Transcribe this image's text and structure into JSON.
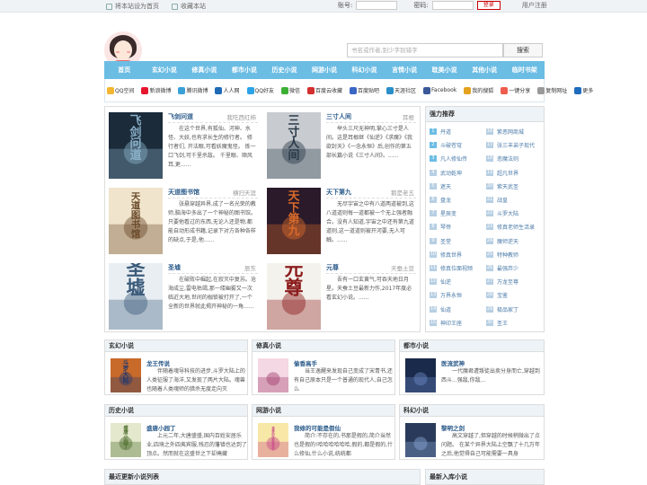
{
  "topbar": {
    "set_home": "将本站设为首页",
    "favorite": "收藏本站",
    "account_label": "账号:",
    "password_label": "密码:",
    "login": "登录",
    "register": "用户注册"
  },
  "search": {
    "placeholder": "书名或作者,别少字别错字",
    "button": "搜索"
  },
  "nav": [
    "首页",
    "玄幻小说",
    "修真小说",
    "都市小说",
    "历史小说",
    "网游小说",
    "科幻小说",
    "言情小说",
    "耽美小说",
    "其他小说",
    "临时书架"
  ],
  "share": [
    {
      "label": "QQ空间",
      "color": "#f2b631"
    },
    {
      "label": "新浪微博",
      "color": "#e6162d"
    },
    {
      "label": "腾讯微博",
      "color": "#3aa1d8"
    },
    {
      "label": "人人网",
      "color": "#1f6ab5"
    },
    {
      "label": "QQ好友",
      "color": "#2ba3e6"
    },
    {
      "label": "微信",
      "color": "#3cb035"
    },
    {
      "label": "百度云收藏",
      "color": "#d32f2f"
    },
    {
      "label": "百度贴吧",
      "color": "#3a66c4"
    },
    {
      "label": "天涯社区",
      "color": "#2a8fc9"
    },
    {
      "label": "Facebook",
      "color": "#3b5998"
    },
    {
      "label": "我的搜狐",
      "color": "#e4a21f"
    },
    {
      "label": "一键分享",
      "color": "#ed5c4d"
    },
    {
      "label": "复制网址",
      "color": "#999999"
    },
    {
      "label": "更多",
      "color": "#1f6bbd"
    }
  ],
  "books": [
    {
      "title": "飞剑问道",
      "author": "我吃西红柿",
      "desc": "在这个世界,有狐仙、河神、水怪、大妖,也有求长生的修行者。 修行者们, 开法眼,可看妖魔鬼怪。 炼一口飞剑,可千里杀敌。 千里眼、顺风耳,更......",
      "cover": [
        "#1b2b3a",
        "#8ab0c8"
      ],
      "cover_text": "飞剑问道"
    },
    {
      "title": "三寸人间",
      "author": "耳根",
      "desc": "举头三尺无神明,掌心三寸是人间。这是耳根继《仙逆》《求魔》《我欲封天》《一念永恒》后,创作的第五部长篇小说《三寸人间》。......",
      "cover": [
        "#c8ccd0",
        "#2a3a4a"
      ],
      "cover_text": "三寸人间"
    },
    {
      "title": "天道图书馆",
      "author": "横扫天涯",
      "desc": "张悬穿越异界,成了一名光荣的教师,脑海中多出了一个神秘的图书馆。只要他看过的东西,无论人还是物,都能自动形成书籍,记录下对方各种各样的缺点,于是,他......",
      "cover": [
        "#f0e4cc",
        "#6a4a2a"
      ],
      "cover_text": "天道图书馆"
    },
    {
      "title": "天下第九",
      "author": "鹅是老五",
      "desc": "无尽宇宙之中有八道两道被到,这八道道则每一道都被一个无上强者融合。没有人知道,宇宙之中还有第九道道则,这一道道则被开河要,无人可触。......",
      "cover": [
        "#2a1a2a",
        "#d86a2a"
      ],
      "cover_text": "天下第九"
    },
    {
      "title": "圣墟",
      "author": "辰东",
      "desc": "在破败中崛起,在寂灭中复苏。沧海成尘,雷电枯竭,那一缕幽雾又一次临近大地,世间的枷锁被打开了,一个全新的世界就此揭开神秘的一角......",
      "cover": [
        "#e8eef2",
        "#3a5a7a"
      ],
      "cover_text": "圣墟"
    },
    {
      "title": "元尊",
      "author": "天蚕土豆",
      "desc": "吾有一口玄黄气,可吞天地日月星。天蚕土豆最新力作,2017年度必看玄幻小说。......",
      "cover": [
        "#f4f2ec",
        "#8a1a1a"
      ],
      "cover_text": "元尊"
    }
  ],
  "rank": {
    "title": "强力推荐",
    "left": [
      "丹道",
      "斗破苍穹",
      "凡人修仙传",
      "武动乾坤",
      "遮天",
      "盘龙",
      "星辰变",
      "琴帝",
      "圣堂",
      "修真世界",
      "修真位面视频",
      "仙逆",
      "万界永恒",
      "仙道",
      "神印王座"
    ],
    "right": [
      "紫恶网商城",
      "张三丰弟子现代",
      "悲魔法则",
      "超凡世界",
      "紫天武圣",
      "战皇",
      "斗罗大陆",
      "修真老师生活录",
      "魔师逆天",
      "特种教师",
      "最强弃少",
      "万龙至尊",
      "宝鉴",
      "极品家丁",
      "圣王"
    ]
  },
  "sections": [
    {
      "name": "玄幻小说",
      "book": "龙王传说",
      "desc": "伴随着魂导科技的进步,斗罗大陆上的人类征服了海洋,又发现了两片大陆。魂兽也随着人类魂师的猎杀无度走向灭",
      "cover": [
        "#c86a2a",
        "#2a3a6a"
      ],
      "cover_text": "斗罗大陆"
    },
    {
      "name": "修真小说",
      "book": "偷香高手",
      "desc": "当王逸醒来发现自己变成了宋青书,还有自己原本只是一个普通的现代人,自己怎么",
      "cover": [
        "#f4d8e4",
        "#a03a6a"
      ],
      "cover_text": ""
    },
    {
      "name": "都市小说",
      "book": "医流武神",
      "desc": "一代魔君遭叛徒出卖分身而亡,穿越到西斗...强敌,你敌...",
      "cover": [
        "#1a2a4a",
        "#6a8ac8"
      ],
      "cover_text": ""
    },
    {
      "name": "历史小说",
      "book": "盛唐小园丁",
      "desc": "上元二年,大唐盛盛,国内百姓安居乐业,四境之外四夷宾服,残忍的藩镇也达到了顶点。然而就在这盛世之下却掩藏",
      "cover": [
        "#e4e8cc",
        "#4a6a2a"
      ],
      "cover_text": "盛唐小园丁"
    },
    {
      "name": "网游小说",
      "book": "我修的可能是假仙",
      "desc": "简介:不存在的,书那是假的,简介当然也是假的!哈哈哈哈哈哈,假的,都是假的,什么修仙,什么小说,统统都",
      "cover": [
        "#f8e8a8",
        "#c84a8a"
      ],
      "cover_text": "我修的可能是假仙"
    },
    {
      "name": "科幻小说",
      "book": "黎明之剑",
      "desc": "高文穿越了,但穿越的时候稍微出了点问题。 在某个异界大陆上空飘了十几万年之后,他觉得自己可能需要一具身",
      "cover": [
        "#2a3a5a",
        "#8aaad8"
      ],
      "cover_text": ""
    }
  ],
  "bottom": {
    "left": "最近更新小说列表",
    "right": "最新入库小说"
  }
}
